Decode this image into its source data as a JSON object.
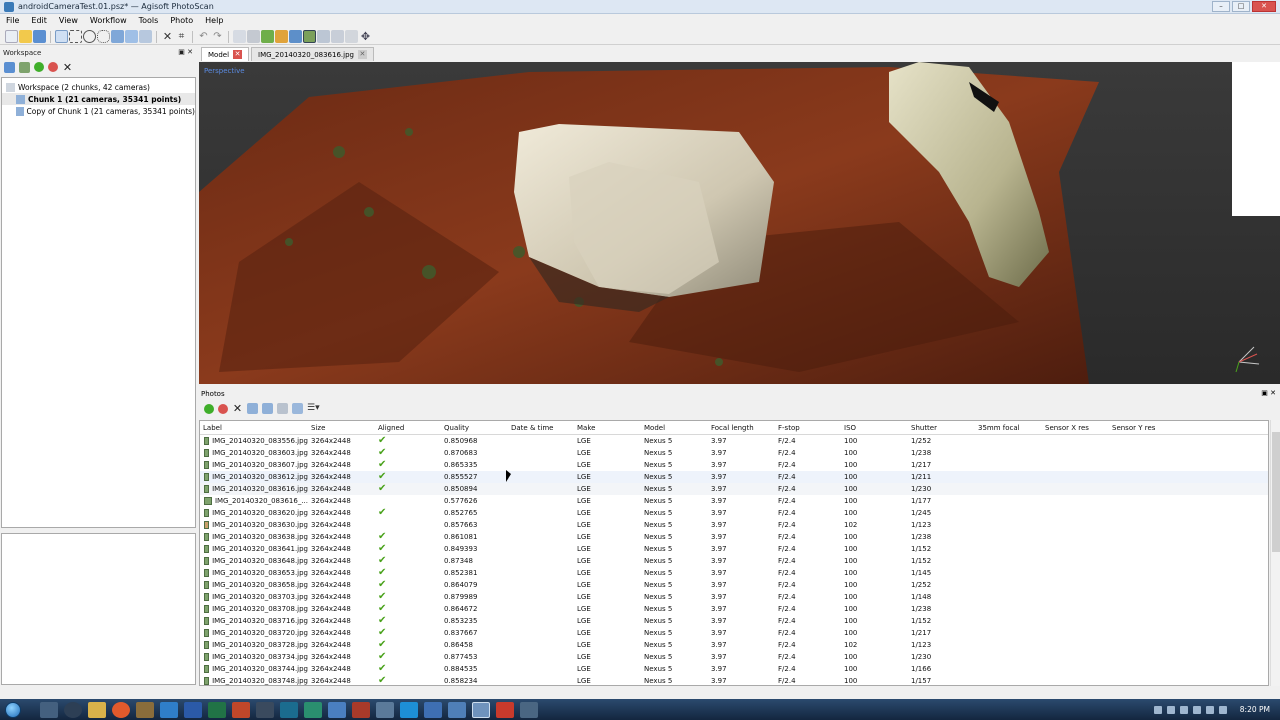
{
  "window": {
    "title": "androidCameraTest.01.psz* — Agisoft PhotoScan",
    "minimize": "–",
    "maximize": "□",
    "close": "✕"
  },
  "menu": [
    "File",
    "Edit",
    "View",
    "Workflow",
    "Tools",
    "Photo",
    "Help"
  ],
  "workspace": {
    "pane_title": "Workspace",
    "pane_ctrl": "▣ ✕",
    "tree": [
      {
        "label": "Workspace (2 chunks, 42 cameras)",
        "indent": 0,
        "bold": false,
        "icon": "workspace-icon"
      },
      {
        "label": "Chunk 1 (21 cameras, 35341 points)",
        "indent": 1,
        "bold": true,
        "icon": "chunk-icon"
      },
      {
        "label": "Copy of Chunk 1 (21 cameras, 35341 points)",
        "indent": 1,
        "bold": false,
        "icon": "chunk-icon"
      }
    ]
  },
  "tabs": [
    {
      "label": "Model",
      "active": true,
      "close": "✕"
    },
    {
      "label": "IMG_20140320_083616.jpg",
      "active": false,
      "close": "✕"
    }
  ],
  "viewport": {
    "mode_label": "Perspective"
  },
  "photos": {
    "pane_title": "Photos",
    "pane_ctrl": "▣ ✕",
    "columns": [
      "Label",
      "Size",
      "Aligned",
      "Quality",
      "Date & time",
      "Make",
      "Model",
      "Focal length",
      "F-stop",
      "ISO",
      "Shutter",
      "35mm focal",
      "Sensor X res",
      "Sensor Y res"
    ],
    "rows": [
      {
        "label": "IMG_20140320_083556.jpg",
        "size": "3264x2448",
        "aligned": true,
        "quality": "0.850968",
        "make": "LGE",
        "model": "Nexus 5",
        "focal": "3.97",
        "fstop": "F/2.4",
        "iso": "100",
        "shutter": "1/252"
      },
      {
        "label": "IMG_20140320_083603.jpg",
        "size": "3264x2448",
        "aligned": true,
        "quality": "0.870683",
        "make": "LGE",
        "model": "Nexus 5",
        "focal": "3.97",
        "fstop": "F/2.4",
        "iso": "100",
        "shutter": "1/238"
      },
      {
        "label": "IMG_20140320_083607.jpg",
        "size": "3264x2448",
        "aligned": true,
        "quality": "0.865335",
        "make": "LGE",
        "model": "Nexus 5",
        "focal": "3.97",
        "fstop": "F/2.4",
        "iso": "100",
        "shutter": "1/217"
      },
      {
        "label": "IMG_20140320_083612.jpg",
        "size": "3264x2448",
        "aligned": true,
        "quality": "0.855527",
        "make": "LGE",
        "model": "Nexus 5",
        "focal": "3.97",
        "fstop": "F/2.4",
        "iso": "100",
        "shutter": "1/211"
      },
      {
        "label": "IMG_20140320_083616.jpg",
        "size": "3264x2448",
        "aligned": true,
        "quality": "0.850894",
        "make": "LGE",
        "model": "Nexus 5",
        "focal": "3.97",
        "fstop": "F/2.4",
        "iso": "100",
        "shutter": "1/230"
      },
      {
        "label": "IMG_20140320_083616_...",
        "size": "3264x2448",
        "aligned": false,
        "quality": "0.577626",
        "make": "LGE",
        "model": "Nexus 5",
        "focal": "3.97",
        "fstop": "F/2.4",
        "iso": "100",
        "shutter": "1/177"
      },
      {
        "label": "IMG_20140320_083620.jpg",
        "size": "3264x2448",
        "aligned": true,
        "quality": "0.852765",
        "make": "LGE",
        "model": "Nexus 5",
        "focal": "3.97",
        "fstop": "F/2.4",
        "iso": "100",
        "shutter": "1/245"
      },
      {
        "label": "IMG_20140320_083630.jpg",
        "size": "3264x2448",
        "aligned": false,
        "quality": "0.857663",
        "make": "LGE",
        "model": "Nexus 5",
        "focal": "3.97",
        "fstop": "F/2.4",
        "iso": "102",
        "shutter": "1/123"
      },
      {
        "label": "IMG_20140320_083638.jpg",
        "size": "3264x2448",
        "aligned": true,
        "quality": "0.861081",
        "make": "LGE",
        "model": "Nexus 5",
        "focal": "3.97",
        "fstop": "F/2.4",
        "iso": "100",
        "shutter": "1/238"
      },
      {
        "label": "IMG_20140320_083641.jpg",
        "size": "3264x2448",
        "aligned": true,
        "quality": "0.849393",
        "make": "LGE",
        "model": "Nexus 5",
        "focal": "3.97",
        "fstop": "F/2.4",
        "iso": "100",
        "shutter": "1/152"
      },
      {
        "label": "IMG_20140320_083648.jpg",
        "size": "3264x2448",
        "aligned": true,
        "quality": "0.87348",
        "make": "LGE",
        "model": "Nexus 5",
        "focal": "3.97",
        "fstop": "F/2.4",
        "iso": "100",
        "shutter": "1/152"
      },
      {
        "label": "IMG_20140320_083653.jpg",
        "size": "3264x2448",
        "aligned": true,
        "quality": "0.852381",
        "make": "LGE",
        "model": "Nexus 5",
        "focal": "3.97",
        "fstop": "F/2.4",
        "iso": "100",
        "shutter": "1/145"
      },
      {
        "label": "IMG_20140320_083658.jpg",
        "size": "3264x2448",
        "aligned": true,
        "quality": "0.864079",
        "make": "LGE",
        "model": "Nexus 5",
        "focal": "3.97",
        "fstop": "F/2.4",
        "iso": "100",
        "shutter": "1/252"
      },
      {
        "label": "IMG_20140320_083703.jpg",
        "size": "3264x2448",
        "aligned": true,
        "quality": "0.879989",
        "make": "LGE",
        "model": "Nexus 5",
        "focal": "3.97",
        "fstop": "F/2.4",
        "iso": "100",
        "shutter": "1/148"
      },
      {
        "label": "IMG_20140320_083708.jpg",
        "size": "3264x2448",
        "aligned": true,
        "quality": "0.864672",
        "make": "LGE",
        "model": "Nexus 5",
        "focal": "3.97",
        "fstop": "F/2.4",
        "iso": "100",
        "shutter": "1/238"
      },
      {
        "label": "IMG_20140320_083716.jpg",
        "size": "3264x2448",
        "aligned": true,
        "quality": "0.853235",
        "make": "LGE",
        "model": "Nexus 5",
        "focal": "3.97",
        "fstop": "F/2.4",
        "iso": "100",
        "shutter": "1/152"
      },
      {
        "label": "IMG_20140320_083720.jpg",
        "size": "3264x2448",
        "aligned": true,
        "quality": "0.837667",
        "make": "LGE",
        "model": "Nexus 5",
        "focal": "3.97",
        "fstop": "F/2.4",
        "iso": "100",
        "shutter": "1/217"
      },
      {
        "label": "IMG_20140320_083728.jpg",
        "size": "3264x2448",
        "aligned": true,
        "quality": "0.86458",
        "make": "LGE",
        "model": "Nexus 5",
        "focal": "3.97",
        "fstop": "F/2.4",
        "iso": "102",
        "shutter": "1/123"
      },
      {
        "label": "IMG_20140320_083734.jpg",
        "size": "3264x2448",
        "aligned": true,
        "quality": "0.877453",
        "make": "LGE",
        "model": "Nexus 5",
        "focal": "3.97",
        "fstop": "F/2.4",
        "iso": "100",
        "shutter": "1/230"
      },
      {
        "label": "IMG_20140320_083744.jpg",
        "size": "3264x2448",
        "aligned": true,
        "quality": "0.884535",
        "make": "LGE",
        "model": "Nexus 5",
        "focal": "3.97",
        "fstop": "F/2.4",
        "iso": "100",
        "shutter": "1/166"
      },
      {
        "label": "IMG_20140320_083748.jpg",
        "size": "3264x2448",
        "aligned": true,
        "quality": "0.858234",
        "make": "LGE",
        "model": "Nexus 5",
        "focal": "3.97",
        "fstop": "F/2.4",
        "iso": "100",
        "shutter": "1/157"
      }
    ],
    "check_glyph": "✔"
  },
  "taskbar": {
    "clock": "8:20 PM"
  },
  "colors": {
    "accent": "#3a7ab8",
    "aligned_check": "#4aa21c",
    "close_red": "#d9534f",
    "viewport_bg": "#2e2e2e"
  }
}
